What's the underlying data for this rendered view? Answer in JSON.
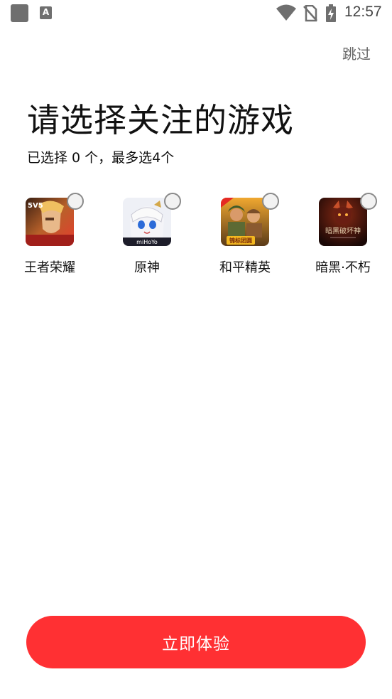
{
  "status_bar": {
    "time": "12:57",
    "icons": [
      "app-icon",
      "a-icon",
      "wifi-icon",
      "no-sim-icon",
      "battery-charging-icon"
    ]
  },
  "header": {
    "skip_label": "跳过"
  },
  "main": {
    "title": "请选择关注的游戏",
    "subtitle": "已选择 0 个，最多选4个",
    "games": [
      {
        "name": "王者荣耀",
        "selected": false,
        "icon_badge": "5V5"
      },
      {
        "name": "原神",
        "selected": false,
        "icon_badge": "miHoYo"
      },
      {
        "name": "和平精英",
        "selected": false,
        "icon_badge": "锦标团圆"
      },
      {
        "name": "暗黑·不朽",
        "selected": false,
        "icon_badge": "暗黑破坏神"
      }
    ]
  },
  "footer": {
    "cta_label": "立即体验"
  },
  "colors": {
    "accent": "#ff3033",
    "text": "#111111",
    "muted": "#666666"
  }
}
